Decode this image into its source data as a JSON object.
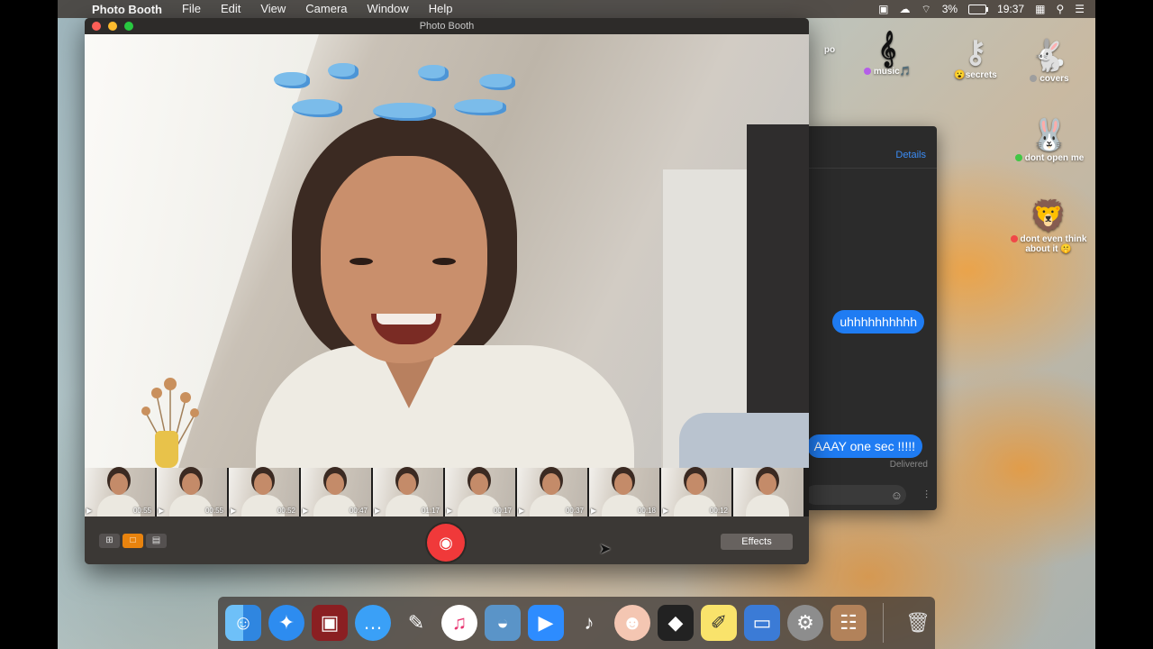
{
  "menubar": {
    "app_name": "Photo Booth",
    "menus": [
      "File",
      "Edit",
      "View",
      "Camera",
      "Window",
      "Help"
    ],
    "battery": "3%",
    "time": "19:37"
  },
  "desktop": {
    "icons": [
      {
        "label": "po"
      },
      {
        "label": "music🎵",
        "dot_color": "#b45ee8"
      },
      {
        "label": "secrets",
        "emoji": "😮"
      },
      {
        "label": "covers",
        "dot_color": "#9e9e9e"
      },
      {
        "label": "dont open me",
        "dot_color": "#41c745"
      },
      {
        "label": "dont even think about it 🤫",
        "dot_color": "#f04848"
      }
    ]
  },
  "messages": {
    "details_label": "Details",
    "bubbles": [
      "uhhhhhhhhhh",
      "AAAY one sec !!!!!"
    ],
    "delivered_label": "Delivered"
  },
  "photobooth": {
    "window_title": "Photo Booth",
    "thumbnails": [
      {
        "duration": "00:55"
      },
      {
        "duration": "00:55"
      },
      {
        "duration": "00:52"
      },
      {
        "duration": "00:47"
      },
      {
        "duration": "01:17"
      },
      {
        "duration": "00:17"
      },
      {
        "duration": "00:37"
      },
      {
        "duration": "00:18"
      },
      {
        "duration": "00:12"
      },
      {
        "duration": ""
      }
    ],
    "effects_label": "Effects"
  },
  "dock": {
    "apps": [
      "finder",
      "safari",
      "photo-booth",
      "messages",
      "inkscape",
      "itunes",
      "sequel-pro",
      "zoom",
      "garageband",
      "face-app",
      "photo-slideshow",
      "stickies",
      "preview",
      "system-preferences",
      "contacts"
    ],
    "trash": "trash"
  },
  "colors": {
    "accent": "#e8830e",
    "shutter": "#f0393a",
    "imessage_blue": "#1f7cf3"
  }
}
